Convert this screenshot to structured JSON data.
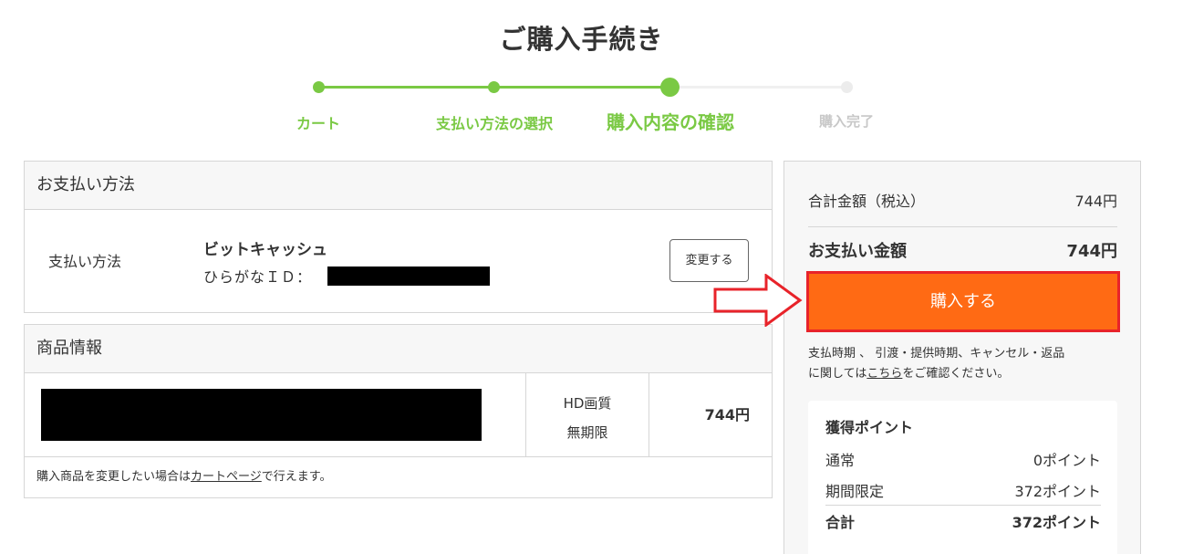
{
  "page": {
    "title": "ご購入手続き"
  },
  "stepper": {
    "steps": [
      {
        "label": "カート",
        "state": "done"
      },
      {
        "label": "支払い方法の選択",
        "state": "done"
      },
      {
        "label": "購入内容の確認",
        "state": "current"
      },
      {
        "label": "購入完了",
        "state": "todo"
      }
    ]
  },
  "payment": {
    "heading": "お支払い方法",
    "label": "支払い方法",
    "method": "ビットキャッシュ",
    "id_label": "ひらがなＩＤ：",
    "change_label": "変更する"
  },
  "product": {
    "heading": "商品情報",
    "quality": "HD画質",
    "period": "無期限",
    "price": "744円",
    "note_prefix": "購入商品を変更したい場合は",
    "note_link": "カートページ",
    "note_suffix": "で行えます。"
  },
  "summary": {
    "total_label": "合計金額（税込）",
    "total_value": "744円",
    "pay_label": "お支払い金額",
    "pay_value": "744円",
    "buy_label": "購入する",
    "terms_line1": "支払時期 、 引渡・提供時期、キャンセル・返品",
    "terms_line2_prefix": "に関しては",
    "terms_link": "こちら",
    "terms_line2_suffix": "をご確認ください。"
  },
  "points": {
    "title": "獲得ポイント",
    "rows": [
      {
        "label": "通常",
        "value": "0ポイント"
      },
      {
        "label": "期間限定",
        "value": "372ポイント"
      },
      {
        "label": "合計",
        "value": "372ポイント"
      }
    ]
  },
  "colors": {
    "accent_green": "#7ac944",
    "buy_orange": "#ff6a14",
    "highlight_red": "#e8232a"
  }
}
